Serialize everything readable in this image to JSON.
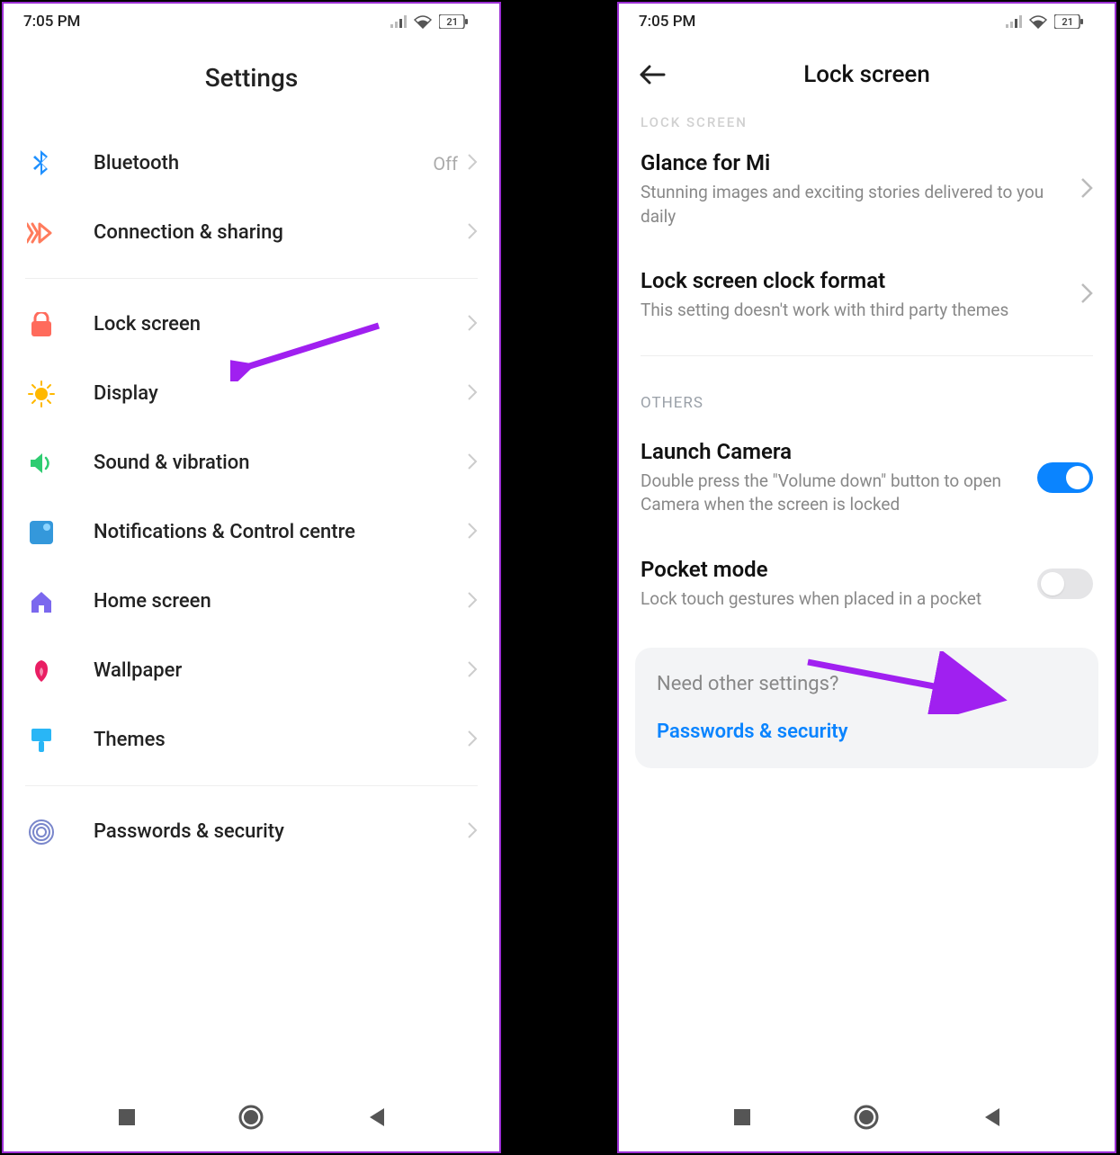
{
  "status": {
    "time": "7:05 PM",
    "battery": "21"
  },
  "colors": {
    "accent_blue": "#0a84ff",
    "purple_arrow": "#a020f0",
    "border": "#9b2fd4"
  },
  "left": {
    "title": "Settings",
    "rows": [
      {
        "id": "bluetooth",
        "label": "Bluetooth",
        "value": "Off",
        "iconColor": "#1e90ff"
      },
      {
        "id": "connection",
        "label": "Connection & sharing",
        "value": "",
        "iconColor": "#ff7b5c"
      }
    ],
    "rows2": [
      {
        "id": "lockscreen",
        "label": "Lock screen",
        "iconColor": "#ff6b5c"
      },
      {
        "id": "display",
        "label": "Display",
        "iconColor": "#ffb800"
      },
      {
        "id": "sound",
        "label": "Sound & vibration",
        "iconColor": "#2ecc71"
      },
      {
        "id": "notif",
        "label": "Notifications & Control centre",
        "iconColor": "#3498db"
      },
      {
        "id": "home",
        "label": "Home screen",
        "iconColor": "#7b68ee"
      },
      {
        "id": "wallpaper",
        "label": "Wallpaper",
        "iconColor": "#e91e63"
      },
      {
        "id": "themes",
        "label": "Themes",
        "iconColor": "#29b6f6"
      }
    ],
    "rows3": [
      {
        "id": "passwords",
        "label": "Passwords & security",
        "iconColor": "#7986cb"
      }
    ]
  },
  "right": {
    "title": "Lock screen",
    "header_cut": "LOCK SCREEN",
    "items1": [
      {
        "id": "glance",
        "title": "Glance for Mi",
        "desc": "Stunning images and exciting stories delivered to you daily"
      },
      {
        "id": "clockfmt",
        "title": "Lock screen clock format",
        "desc": "This setting doesn't work with third party themes"
      }
    ],
    "section_others": "OTHERS",
    "items2": [
      {
        "id": "camera",
        "title": "Launch Camera",
        "desc": "Double press the \"Volume down\" button to open Camera when the screen is locked",
        "toggle": true
      },
      {
        "id": "pocket",
        "title": "Pocket mode",
        "desc": "Lock touch gestures when placed in a pocket",
        "toggle": false
      }
    ],
    "card": {
      "question": "Need other settings?",
      "link": "Passwords & security"
    }
  }
}
